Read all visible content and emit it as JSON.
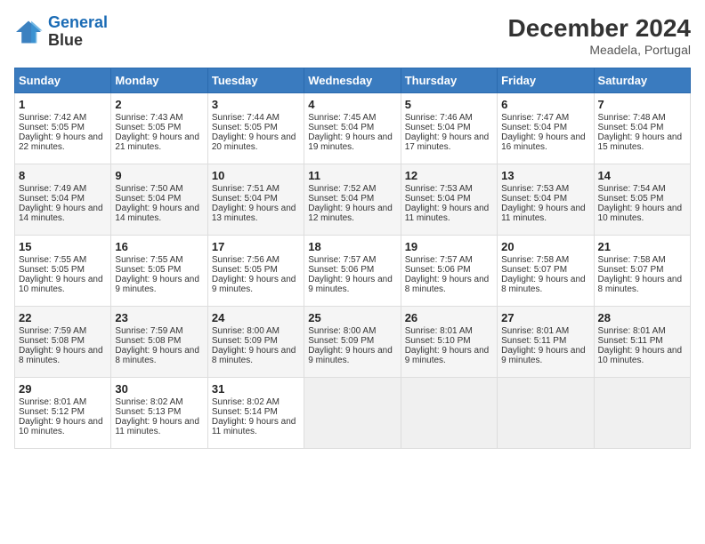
{
  "header": {
    "logo_line1": "General",
    "logo_line2": "Blue",
    "month": "December 2024",
    "location": "Meadela, Portugal"
  },
  "days_of_week": [
    "Sunday",
    "Monday",
    "Tuesday",
    "Wednesday",
    "Thursday",
    "Friday",
    "Saturday"
  ],
  "weeks": [
    [
      {
        "day": "1",
        "sunrise": "7:42 AM",
        "sunset": "5:05 PM",
        "daylight": "9 hours and 22 minutes."
      },
      {
        "day": "2",
        "sunrise": "7:43 AM",
        "sunset": "5:05 PM",
        "daylight": "9 hours and 21 minutes."
      },
      {
        "day": "3",
        "sunrise": "7:44 AM",
        "sunset": "5:05 PM",
        "daylight": "9 hours and 20 minutes."
      },
      {
        "day": "4",
        "sunrise": "7:45 AM",
        "sunset": "5:04 PM",
        "daylight": "9 hours and 19 minutes."
      },
      {
        "day": "5",
        "sunrise": "7:46 AM",
        "sunset": "5:04 PM",
        "daylight": "9 hours and 17 minutes."
      },
      {
        "day": "6",
        "sunrise": "7:47 AM",
        "sunset": "5:04 PM",
        "daylight": "9 hours and 16 minutes."
      },
      {
        "day": "7",
        "sunrise": "7:48 AM",
        "sunset": "5:04 PM",
        "daylight": "9 hours and 15 minutes."
      }
    ],
    [
      {
        "day": "8",
        "sunrise": "7:49 AM",
        "sunset": "5:04 PM",
        "daylight": "9 hours and 14 minutes."
      },
      {
        "day": "9",
        "sunrise": "7:50 AM",
        "sunset": "5:04 PM",
        "daylight": "9 hours and 14 minutes."
      },
      {
        "day": "10",
        "sunrise": "7:51 AM",
        "sunset": "5:04 PM",
        "daylight": "9 hours and 13 minutes."
      },
      {
        "day": "11",
        "sunrise": "7:52 AM",
        "sunset": "5:04 PM",
        "daylight": "9 hours and 12 minutes."
      },
      {
        "day": "12",
        "sunrise": "7:53 AM",
        "sunset": "5:04 PM",
        "daylight": "9 hours and 11 minutes."
      },
      {
        "day": "13",
        "sunrise": "7:53 AM",
        "sunset": "5:04 PM",
        "daylight": "9 hours and 11 minutes."
      },
      {
        "day": "14",
        "sunrise": "7:54 AM",
        "sunset": "5:05 PM",
        "daylight": "9 hours and 10 minutes."
      }
    ],
    [
      {
        "day": "15",
        "sunrise": "7:55 AM",
        "sunset": "5:05 PM",
        "daylight": "9 hours and 10 minutes."
      },
      {
        "day": "16",
        "sunrise": "7:55 AM",
        "sunset": "5:05 PM",
        "daylight": "9 hours and 9 minutes."
      },
      {
        "day": "17",
        "sunrise": "7:56 AM",
        "sunset": "5:05 PM",
        "daylight": "9 hours and 9 minutes."
      },
      {
        "day": "18",
        "sunrise": "7:57 AM",
        "sunset": "5:06 PM",
        "daylight": "9 hours and 9 minutes."
      },
      {
        "day": "19",
        "sunrise": "7:57 AM",
        "sunset": "5:06 PM",
        "daylight": "9 hours and 8 minutes."
      },
      {
        "day": "20",
        "sunrise": "7:58 AM",
        "sunset": "5:07 PM",
        "daylight": "9 hours and 8 minutes."
      },
      {
        "day": "21",
        "sunrise": "7:58 AM",
        "sunset": "5:07 PM",
        "daylight": "9 hours and 8 minutes."
      }
    ],
    [
      {
        "day": "22",
        "sunrise": "7:59 AM",
        "sunset": "5:08 PM",
        "daylight": "9 hours and 8 minutes."
      },
      {
        "day": "23",
        "sunrise": "7:59 AM",
        "sunset": "5:08 PM",
        "daylight": "9 hours and 8 minutes."
      },
      {
        "day": "24",
        "sunrise": "8:00 AM",
        "sunset": "5:09 PM",
        "daylight": "9 hours and 8 minutes."
      },
      {
        "day": "25",
        "sunrise": "8:00 AM",
        "sunset": "5:09 PM",
        "daylight": "9 hours and 9 minutes."
      },
      {
        "day": "26",
        "sunrise": "8:01 AM",
        "sunset": "5:10 PM",
        "daylight": "9 hours and 9 minutes."
      },
      {
        "day": "27",
        "sunrise": "8:01 AM",
        "sunset": "5:11 PM",
        "daylight": "9 hours and 9 minutes."
      },
      {
        "day": "28",
        "sunrise": "8:01 AM",
        "sunset": "5:11 PM",
        "daylight": "9 hours and 10 minutes."
      }
    ],
    [
      {
        "day": "29",
        "sunrise": "8:01 AM",
        "sunset": "5:12 PM",
        "daylight": "9 hours and 10 minutes."
      },
      {
        "day": "30",
        "sunrise": "8:02 AM",
        "sunset": "5:13 PM",
        "daylight": "9 hours and 11 minutes."
      },
      {
        "day": "31",
        "sunrise": "8:02 AM",
        "sunset": "5:14 PM",
        "daylight": "9 hours and 11 minutes."
      },
      null,
      null,
      null,
      null
    ]
  ]
}
